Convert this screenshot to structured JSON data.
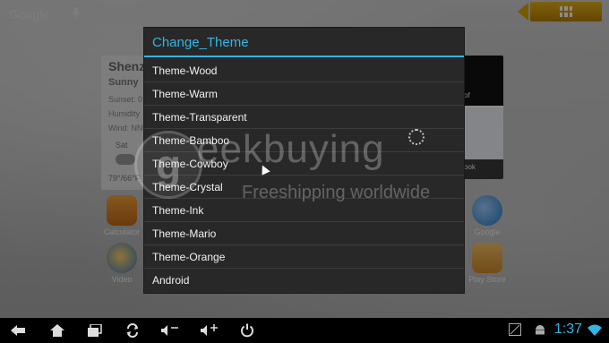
{
  "search": {
    "label": "Google"
  },
  "weather": {
    "city": "Shenz",
    "condition": "Sunny",
    "lines": [
      "Sunset: 0",
      "Humidity",
      "Wind: NN"
    ],
    "day": "Sat",
    "temp": "79°/66°F"
  },
  "thumbs": {
    "label1": "of",
    "label2": "ook"
  },
  "apps": {
    "calculator": "Calculator",
    "google": "Google",
    "video": "Video",
    "play_store": "Play Store"
  },
  "dialog": {
    "title": "Change_Theme",
    "options": [
      "Theme-Wood",
      "Theme-Warm",
      "Theme-Transparent",
      "Theme-Bamboo",
      "Theme-Cowboy",
      "Theme-Crystal",
      "Theme-Ink",
      "Theme-Mario",
      "Theme-Orange",
      "Android"
    ]
  },
  "watermark": {
    "brand": "eekbuying",
    "letter": "g",
    "tagline": "Freeshipping worldwide"
  },
  "statusbar": {
    "time": "1:37"
  },
  "colors": {
    "accent": "#33b5e5",
    "apps_button": "#d8a300",
    "dialog_bg": "#282828"
  },
  "icons": [
    "microphone-icon",
    "apps-grid-icon",
    "back-icon",
    "home-icon",
    "recent-apps-icon",
    "rotate-icon",
    "volume-down-icon",
    "volume-up-icon",
    "power-icon",
    "screenshot-icon",
    "android-icon",
    "wifi-icon"
  ]
}
